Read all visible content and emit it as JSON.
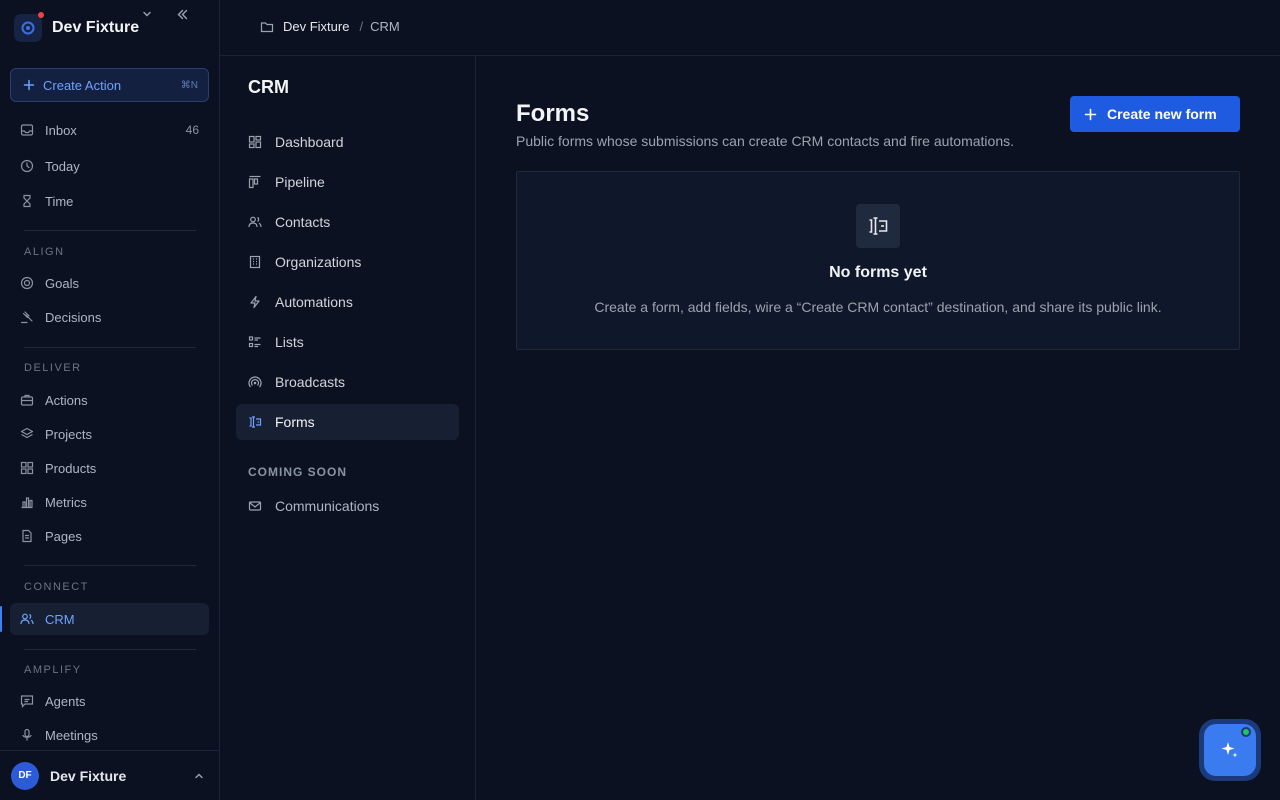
{
  "workspace": {
    "name": "Dev Fixture"
  },
  "create_action": {
    "label": "Create Action",
    "shortcut": "⌘N"
  },
  "sidebar": {
    "top_items": [
      {
        "label": "Inbox",
        "count": "46",
        "icon": "inbox-icon"
      },
      {
        "label": "Today",
        "icon": "clock-icon"
      },
      {
        "label": "Time",
        "icon": "hourglass-icon"
      }
    ],
    "sections": {
      "align": "ALIGN",
      "deliver": "DELIVER",
      "connect": "CONNECT",
      "amplify": "AMPLIFY"
    },
    "align_items": [
      {
        "label": "Goals",
        "icon": "target-icon"
      },
      {
        "label": "Decisions",
        "icon": "gavel-icon"
      }
    ],
    "deliver_items": [
      {
        "label": "Actions",
        "icon": "briefcase-icon"
      },
      {
        "label": "Projects",
        "icon": "layers-icon"
      },
      {
        "label": "Products",
        "icon": "grid-icon"
      },
      {
        "label": "Metrics",
        "icon": "bar-chart-icon"
      },
      {
        "label": "Pages",
        "icon": "document-icon"
      }
    ],
    "connect_items": [
      {
        "label": "CRM",
        "icon": "users-icon",
        "active": true
      }
    ],
    "amplify_items": [
      {
        "label": "Agents",
        "icon": "message-icon"
      },
      {
        "label": "Meetings",
        "icon": "microphone-icon"
      }
    ]
  },
  "user": {
    "initials": "DF",
    "name": "Dev Fixture"
  },
  "breadcrumb": {
    "items": [
      "Dev Fixture",
      "CRM"
    ],
    "separator": "/"
  },
  "crm_nav": {
    "title": "CRM",
    "items": [
      {
        "label": "Dashboard",
        "icon": "dashboard-icon"
      },
      {
        "label": "Pipeline",
        "icon": "pipeline-icon"
      },
      {
        "label": "Contacts",
        "icon": "contacts-icon"
      },
      {
        "label": "Organizations",
        "icon": "building-icon"
      },
      {
        "label": "Automations",
        "icon": "lightning-icon"
      },
      {
        "label": "Lists",
        "icon": "list-icon"
      },
      {
        "label": "Broadcasts",
        "icon": "broadcast-icon"
      },
      {
        "label": "Forms",
        "icon": "form-icon",
        "active": true
      }
    ],
    "coming_soon_label": "COMING SOON",
    "coming_soon_items": [
      {
        "label": "Communications",
        "icon": "mail-icon"
      }
    ]
  },
  "main": {
    "title": "Forms",
    "subtitle": "Public forms whose submissions can create CRM contacts and fire automations.",
    "create_button": "Create new form",
    "empty_state": {
      "title": "No forms yet",
      "description": "Create a form, add fields, wire a “Create CRM contact” destination, and share its public link."
    }
  },
  "colors": {
    "background": "#0b1120",
    "accent": "#3b82f6",
    "primary_button": "#1f5be0",
    "status_online": "#22c55e"
  }
}
